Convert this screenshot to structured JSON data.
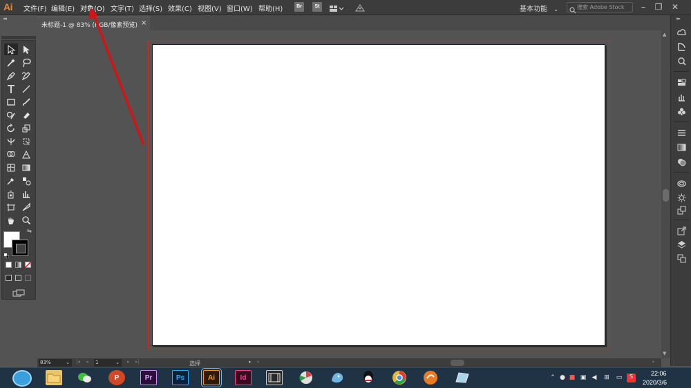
{
  "app": {
    "logo_text": "Ai",
    "accent_color": "#e98b3a"
  },
  "menu": {
    "items": [
      {
        "label": "文件(F)"
      },
      {
        "label": "编辑(E)"
      },
      {
        "label": "对象(O)"
      },
      {
        "label": "文字(T)"
      },
      {
        "label": "选择(S)"
      },
      {
        "label": "效果(C)"
      },
      {
        "label": "视图(V)"
      },
      {
        "label": "窗口(W)"
      },
      {
        "label": "帮助(H)"
      }
    ],
    "bridge_label": "Br",
    "stock_label": "St",
    "workspace_label": "基本功能",
    "search_placeholder": "搜索 Adobe Stock",
    "minimize_icon": "minimize-icon",
    "maximize_icon": "maximize-icon",
    "close_icon": "close-icon"
  },
  "document": {
    "tab_title": "未标题-1 @ 83% (RGB/像素预览)",
    "tab_close": "×",
    "artboard_color": "#ffffff",
    "bleed_color": "#c4302f"
  },
  "tools": {
    "selected": "selection-tool",
    "fill_color": "#ffffff",
    "stroke_color": "#000000"
  },
  "status": {
    "zoom": "83%",
    "page": "1",
    "tool_text": "选择"
  },
  "taskbar": {
    "apps": [
      {
        "name": "file-explorer-app",
        "color": "#e8c46a"
      },
      {
        "name": "wechat-app",
        "color": "#3fbd3c"
      },
      {
        "name": "powerpoint-app",
        "color": "#d24726",
        "label": "P"
      },
      {
        "name": "premiere-app",
        "color": "#2a0f3d",
        "label": "Pr"
      },
      {
        "name": "photoshop-app",
        "color": "#0b2236",
        "label": "Ps"
      },
      {
        "name": "illustrator-app",
        "color": "#2f1a0a",
        "label": "Ai"
      },
      {
        "name": "indesign-app",
        "color": "#3a0a1f",
        "label": "Id"
      },
      {
        "name": "video-app",
        "color": "#2a2a2a"
      },
      {
        "name": "media-app",
        "color": "#e0e0e0"
      },
      {
        "name": "notepad-app",
        "color": "#6fb6e0"
      },
      {
        "name": "qq-app",
        "color": "#f5f5f5"
      },
      {
        "name": "chrome-app",
        "color": "#e8b63b"
      },
      {
        "name": "browser-app",
        "color": "#e97c22"
      },
      {
        "name": "utility-app",
        "color": "#a9d4ea"
      }
    ],
    "clock_time": "22:06",
    "clock_date": "2020/3/6"
  }
}
